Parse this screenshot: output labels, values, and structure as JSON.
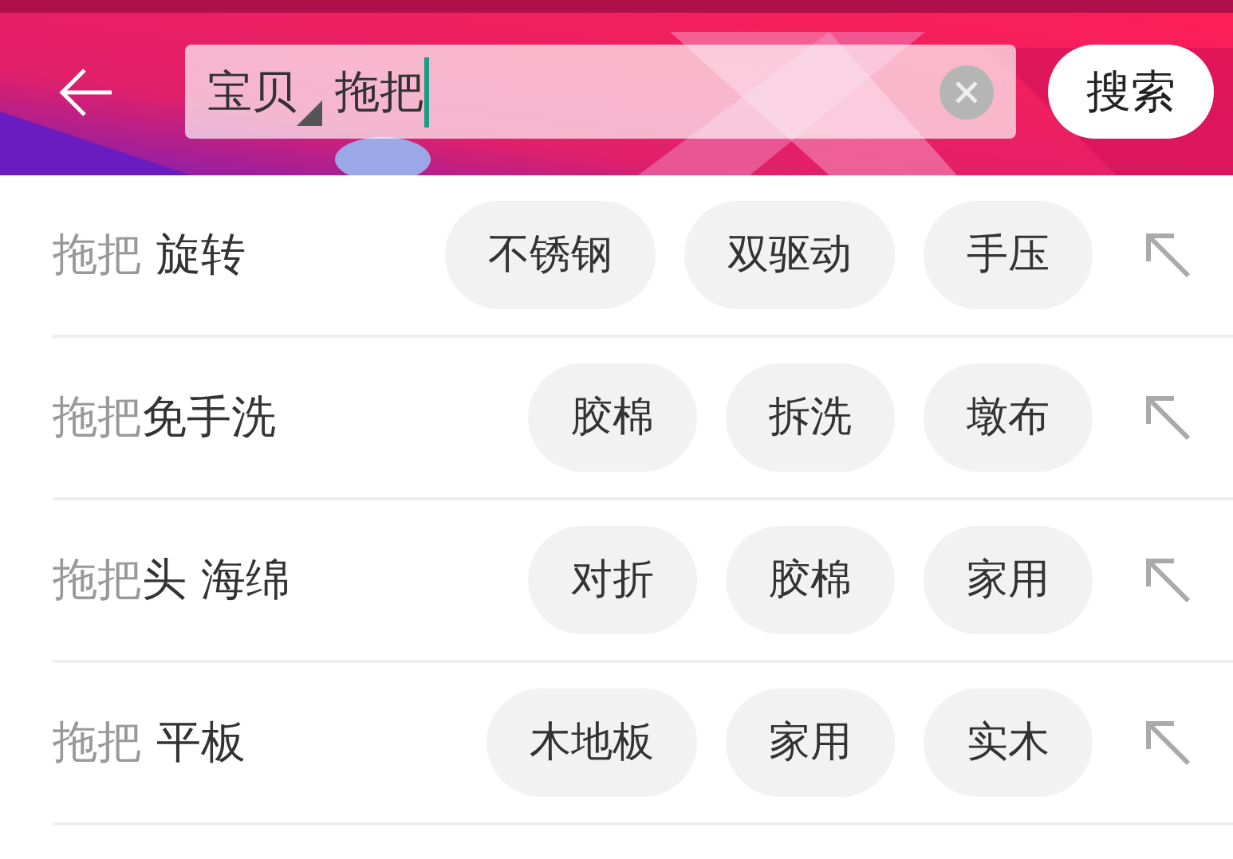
{
  "search_bar": {
    "scope": "宝贝",
    "query": "拖把",
    "search_button": "搜索"
  },
  "suggestions": [
    {
      "match": "拖把",
      "rest": " 旋转",
      "tags": [
        "不锈钢",
        "双驱动",
        "手压"
      ]
    },
    {
      "match": "拖把",
      "rest": "免手洗",
      "tags": [
        "胶棉",
        "拆洗",
        "墩布"
      ]
    },
    {
      "match": "拖把",
      "rest": "头 海绵",
      "tags": [
        "对折",
        "胶棉",
        "家用"
      ]
    },
    {
      "match": "拖把",
      "rest": " 平板",
      "tags": [
        "木地板",
        "家用",
        "实木"
      ]
    }
  ]
}
